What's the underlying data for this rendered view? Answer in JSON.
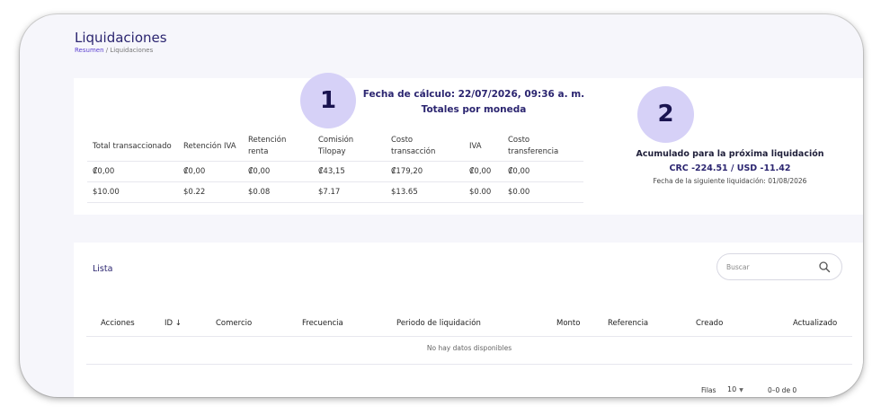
{
  "header": {
    "title": "Liquidaciones",
    "breadcrumb": {
      "home": "Resumen",
      "separator": "/",
      "current": "Liquidaciones"
    }
  },
  "badges": {
    "one": "1",
    "two": "2"
  },
  "summary": {
    "calc_date": "Fecha de cálculo: 22/07/2026, 09:36 a. m.",
    "totals_title": "Totales por moneda",
    "columns": [
      "Total transaccionado",
      "Retención IVA",
      "Retención renta",
      "Comisión Tilopay",
      "Costo transacción",
      "IVA",
      "Costo transferencia"
    ],
    "rows": [
      [
        "₡0,00",
        "₡0,00",
        "₡0,00",
        "₡43,15",
        "₡179,20",
        "₡0,00",
        "₡0,00"
      ],
      [
        "$10.00",
        "$0.22",
        "$0.08",
        "$7.17",
        "$13.65",
        "$0.00",
        "$0.00"
      ]
    ]
  },
  "accumulated": {
    "title": "Acumulado para la próxima liquidación",
    "values": "CRC -224.51 / USD -11.42",
    "next_date": "Fecha de la siguiente liquidación: 01/08/2026"
  },
  "list": {
    "title": "Lista",
    "search_placeholder": "Buscar",
    "columns": [
      "Acciones",
      "ID ↓",
      "Comercio",
      "Frecuencia",
      "Periodo de liquidación",
      "Monto",
      "Referencia",
      "Creado",
      "Actualizado"
    ],
    "empty_text": "No hay datos disponibles",
    "pagination": {
      "rows_label": "Filas",
      "rows_value": "10",
      "range": "0–0 de 0"
    }
  },
  "colors": {
    "accent": "#2b2570",
    "badge": "#d6d1f7",
    "link": "#5b3fd0"
  },
  "icons": [
    "search-icon",
    "sort-down-arrow",
    "chevron-down-icon"
  ]
}
